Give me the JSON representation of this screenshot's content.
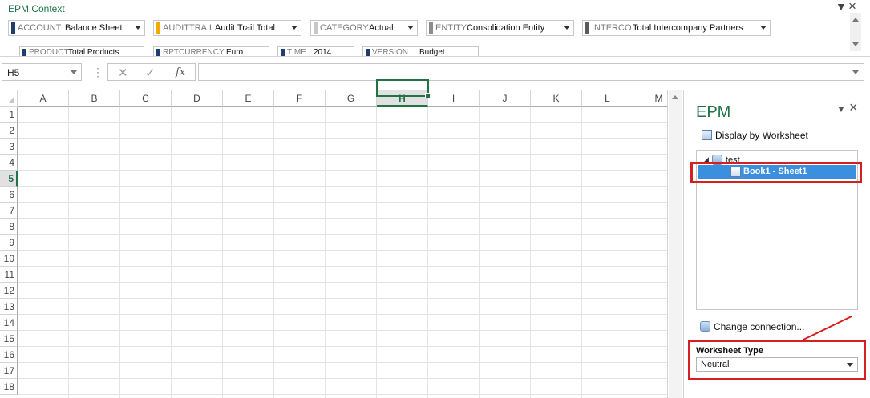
{
  "context_pane": {
    "title": "EPM Context",
    "pin_icon": "chevron-down-icon",
    "close_icon": "close-icon",
    "dimensions": [
      {
        "label": "ACCOUNT",
        "value": "Balance Sheet",
        "color": "#1f3d6e"
      },
      {
        "label": "AUDITTRAIL",
        "value": "Audit Trail Total",
        "color": "#f2a900"
      },
      {
        "label": "CATEGORY",
        "value": "Actual",
        "color": "#c8c8c8"
      },
      {
        "label": "ENTITY",
        "value": "Consolidation Entity",
        "color": "#8c8c8c"
      },
      {
        "label": "INTERCO",
        "value": "Total Intercompany Partners",
        "color": "#5a5a5a"
      }
    ],
    "dimensions_row2": [
      {
        "label": "PRODUCT",
        "value": "Total Products",
        "color": "#1f3d6e"
      },
      {
        "label": "RPTCURRENCY",
        "value": "Euro",
        "color": "#1f3d6e"
      },
      {
        "label": "TIME",
        "value": "2014",
        "color": "#1f3d6e"
      },
      {
        "label": "VERSION",
        "value": "Budget",
        "color": "#1f3d6e"
      }
    ]
  },
  "formula_bar": {
    "name_box": "H5",
    "fx_label": "fx",
    "formula": ""
  },
  "grid": {
    "columns": [
      "A",
      "B",
      "C",
      "D",
      "E",
      "F",
      "G",
      "H",
      "I",
      "J",
      "K",
      "L",
      "M"
    ],
    "rows": [
      "1",
      "2",
      "3",
      "4",
      "5",
      "6",
      "7",
      "8",
      "9",
      "10",
      "11",
      "12",
      "13",
      "14",
      "15",
      "16",
      "17",
      "18"
    ],
    "selected_column": "H",
    "selected_row": "5",
    "active_cell": "H5"
  },
  "epm_pane": {
    "title": "EPM",
    "display_option": "Display by Worksheet",
    "tree": {
      "root": "test",
      "item": "Book1 - Sheet1"
    },
    "change_connection": "Change connection...",
    "worksheet_type_label": "Worksheet Type",
    "worksheet_type_value": "Neutral",
    "highlight_color": "#d62020",
    "accent_color": "#217346"
  }
}
